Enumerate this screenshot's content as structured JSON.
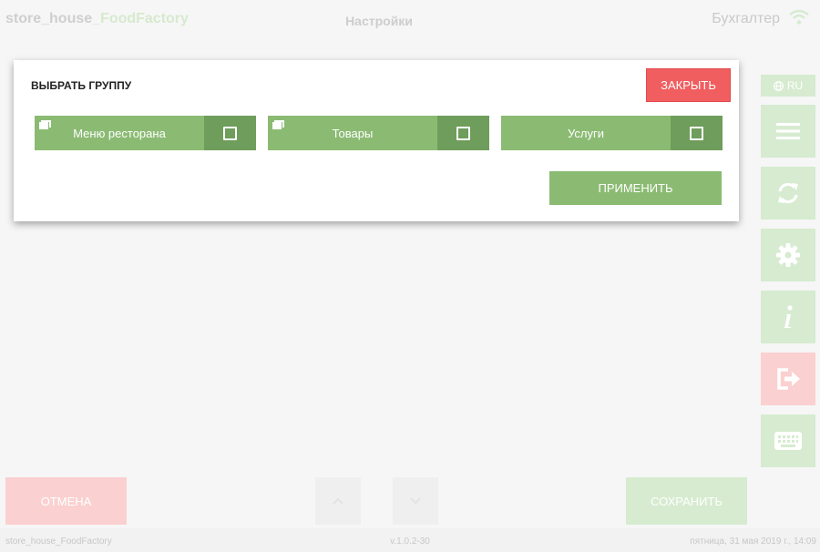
{
  "header": {
    "app_name_prefix": "store_house",
    "app_name_brand": "_FoodFactory",
    "screen_title": "Настройки",
    "user": "Бухгалтер"
  },
  "sidebar": {
    "language": "RU",
    "buttons": [
      "menu-icon",
      "sync-icon",
      "gear-icon",
      "info-icon",
      "logout-icon",
      "keyboard-icon"
    ]
  },
  "modal": {
    "title": "ВЫБРАТЬ ГРУППУ",
    "close_label": "ЗАКРЫТЬ",
    "groups": [
      {
        "label": "Меню ресторана",
        "checked": false
      },
      {
        "label": "Товары",
        "checked": false
      },
      {
        "label": "Услуги",
        "checked": false
      }
    ],
    "apply_label": "ПРИМЕНИТЬ"
  },
  "bottom": {
    "cancel_label": "ОТМЕНА",
    "save_label": "СОХРАНИТЬ"
  },
  "footer": {
    "app_name": "store_house_FoodFactory",
    "version": "v.1.0.2-30",
    "datetime": "пятница, 31 мая 2019 г., 14:09"
  },
  "colors": {
    "accent_green": "#8bbb73",
    "accent_green_dark": "#6f9d5b",
    "close_red": "#f05e60",
    "faded_green": "#d6ebd0",
    "faded_red": "#fbd0d0"
  }
}
